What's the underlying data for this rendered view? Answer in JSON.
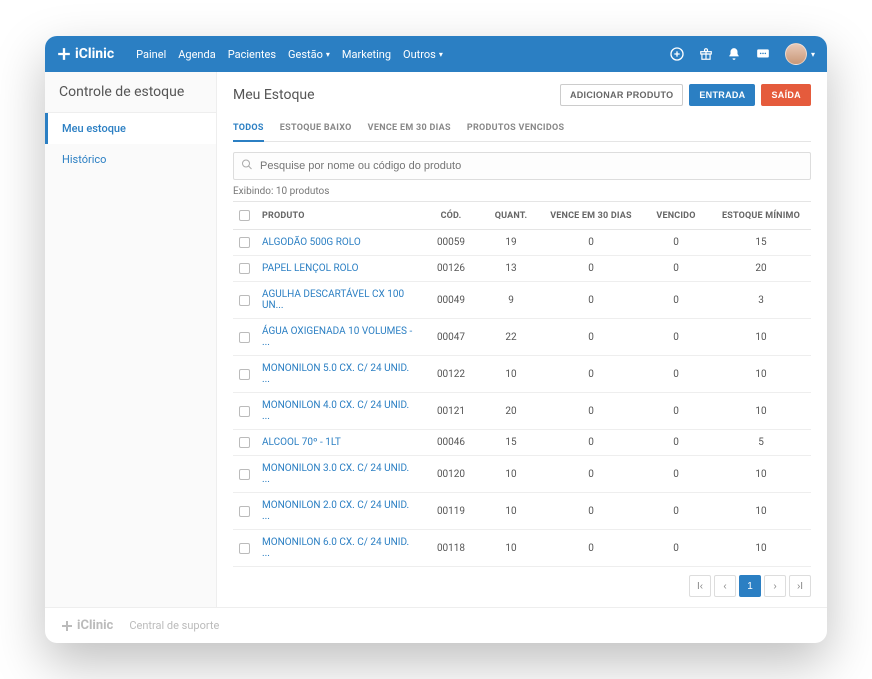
{
  "brand": "iClinic",
  "nav": {
    "painel": "Painel",
    "agenda": "Agenda",
    "pacientes": "Pacientes",
    "gestao": "Gestão",
    "marketing": "Marketing",
    "outros": "Outros"
  },
  "sidebar": {
    "title": "Controle de estoque",
    "items": [
      {
        "label": "Meu estoque"
      },
      {
        "label": "Histórico"
      }
    ]
  },
  "page": {
    "title": "Meu Estoque",
    "actions": {
      "add": "ADICIONAR PRODUTO",
      "in": "ENTRADA",
      "out": "SAÍDA"
    }
  },
  "tabs": {
    "all": "TODOS",
    "low": "ESTOQUE BAIXO",
    "expire30": "VENCE EM 30 DIAS",
    "expired": "PRODUTOS VENCIDOS"
  },
  "search": {
    "placeholder": "Pesquise por nome ou código do produto"
  },
  "showing": "Exibindo: 10 produtos",
  "columns": {
    "produto": "PRODUTO",
    "cod": "CÓD.",
    "quant": "QUANT.",
    "vence30": "VENCE EM 30 DIAS",
    "vencido": "VENCIDO",
    "min": "ESTOQUE MÍNIMO"
  },
  "rows": [
    {
      "name": "ALGODÃO 500G ROLO",
      "cod": "00059",
      "qty": "19",
      "v30": "0",
      "venc": "0",
      "min": "15"
    },
    {
      "name": "PAPEL LENÇOL ROLO",
      "cod": "00126",
      "qty": "13",
      "v30": "0",
      "venc": "0",
      "min": "20"
    },
    {
      "name": "AGULHA DESCARTÁVEL CX 100 UN...",
      "cod": "00049",
      "qty": "9",
      "v30": "0",
      "venc": "0",
      "min": "3"
    },
    {
      "name": "ÁGUA OXIGENADA 10 VOLUMES - ...",
      "cod": "00047",
      "qty": "22",
      "v30": "0",
      "venc": "0",
      "min": "10"
    },
    {
      "name": "MONONILON 5.0 CX. C/ 24 UNID. ...",
      "cod": "00122",
      "qty": "10",
      "v30": "0",
      "venc": "0",
      "min": "10"
    },
    {
      "name": "MONONILON 4.0 CX. C/ 24 UNID. ...",
      "cod": "00121",
      "qty": "20",
      "v30": "0",
      "venc": "0",
      "min": "10"
    },
    {
      "name": "ALCOOL 70º - 1LT",
      "cod": "00046",
      "qty": "15",
      "v30": "0",
      "venc": "0",
      "min": "5"
    },
    {
      "name": "MONONILON 3.0 CX. C/ 24 UNID. ...",
      "cod": "00120",
      "qty": "10",
      "v30": "0",
      "venc": "0",
      "min": "10"
    },
    {
      "name": "MONONILON 2.0 CX. C/ 24 UNID. ...",
      "cod": "00119",
      "qty": "10",
      "v30": "0",
      "venc": "0",
      "min": "10"
    },
    {
      "name": "MONONILON 6.0 CX. C/ 24 UNID. ...",
      "cod": "00118",
      "qty": "10",
      "v30": "0",
      "venc": "0",
      "min": "10"
    }
  ],
  "pagination": {
    "current": "1"
  },
  "footer": {
    "brand": "iClinic",
    "support": "Central de suporte"
  }
}
